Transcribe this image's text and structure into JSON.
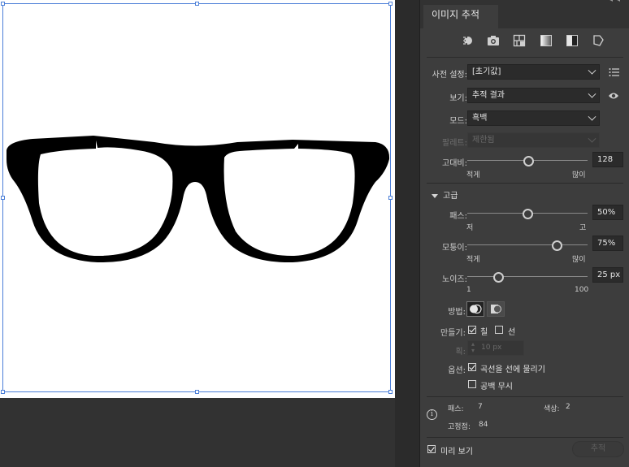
{
  "panel": {
    "title": "이미지 추적",
    "mode_icons": [
      "auto-color-icon",
      "high-color-photo-icon",
      "low-color-icon",
      "grayscale-icon",
      "black-and-white-icon",
      "outline-icon"
    ],
    "preset": {
      "label": "사전 설정:",
      "value": "[초기값]"
    },
    "view": {
      "label": "보기:",
      "value": "추적 결과"
    },
    "mode": {
      "label": "모드:",
      "value": "흑백"
    },
    "palette": {
      "label": "팔레트:",
      "value": "제한됨"
    },
    "threshold": {
      "label": "고대비:",
      "value": "128",
      "min_label": "적게",
      "max_label": "많이",
      "level": 0.5
    },
    "advanced": {
      "label": "고급"
    },
    "paths": {
      "label": "패스:",
      "value": "50%",
      "min_label": "저",
      "max_label": "고",
      "level": 0.5
    },
    "corners": {
      "label": "모퉁이:",
      "value": "75%",
      "min_label": "적게",
      "max_label": "많이",
      "level": 0.75
    },
    "noise": {
      "label": "노이즈:",
      "value": "25 px",
      "min_label": "1",
      "max_label": "100",
      "level": 0.24
    },
    "method": {
      "label": "방법:"
    },
    "create": {
      "label": "만들기:",
      "fill_label": "칠",
      "fill_checked": true,
      "stroke_label": "선",
      "stroke_checked": false
    },
    "stroke_width": {
      "label": "획:",
      "value": "10 px"
    },
    "options": {
      "label": "옵션:",
      "snap_label": "곡선을 선에 물리기",
      "snap_checked": true,
      "ignore_white_label": "공백 무시",
      "ignore_white_checked": false
    },
    "info": {
      "paths_label": "패스:",
      "paths_value": "7",
      "colors_label": "색상:",
      "colors_value": "2",
      "anchors_label": "고정점:",
      "anchors_value": "84"
    },
    "preview": {
      "label": "미리 보기",
      "checked": true
    },
    "trace_button": "추적"
  }
}
